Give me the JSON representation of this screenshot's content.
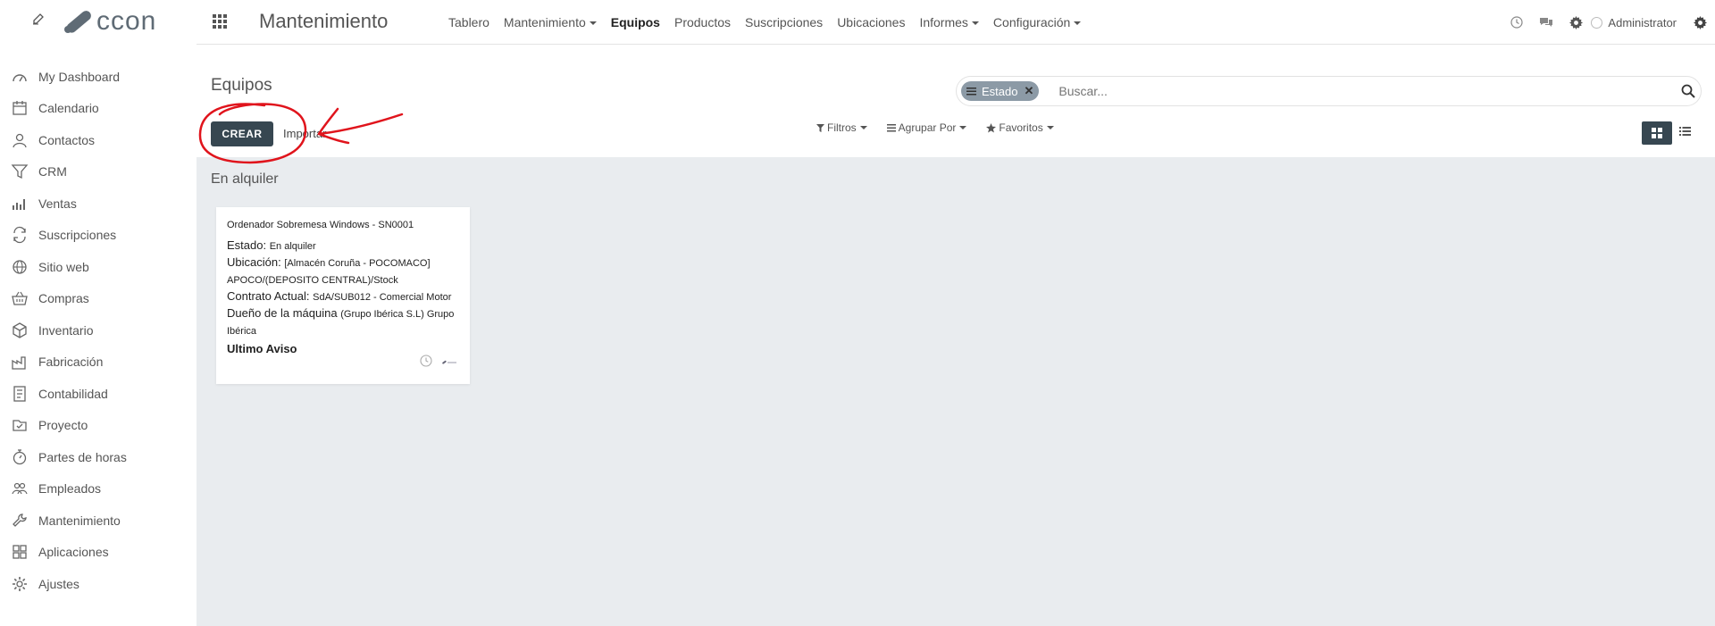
{
  "sidebar": {
    "logo_text": "ccon",
    "items": [
      {
        "label": "My Dashboard",
        "icon": "dashboard-icon"
      },
      {
        "label": "Calendario",
        "icon": "calendar-icon"
      },
      {
        "label": "Contactos",
        "icon": "contacts-icon"
      },
      {
        "label": "CRM",
        "icon": "filter-funnel-icon"
      },
      {
        "label": "Ventas",
        "icon": "sales-chart-icon"
      },
      {
        "label": "Suscripciones",
        "icon": "subscriptions-icon"
      },
      {
        "label": "Sitio web",
        "icon": "globe-icon"
      },
      {
        "label": "Compras",
        "icon": "basket-icon"
      },
      {
        "label": "Inventario",
        "icon": "box-icon"
      },
      {
        "label": "Fabricación",
        "icon": "factory-icon"
      },
      {
        "label": "Contabilidad",
        "icon": "accounting-icon"
      },
      {
        "label": "Proyecto",
        "icon": "project-icon"
      },
      {
        "label": "Partes de horas",
        "icon": "stopwatch-icon"
      },
      {
        "label": "Empleados",
        "icon": "employees-icon"
      },
      {
        "label": "Mantenimiento",
        "icon": "wrench-icon"
      },
      {
        "label": "Aplicaciones",
        "icon": "apps-grid-icon"
      },
      {
        "label": "Ajustes",
        "icon": "gear-icon"
      }
    ]
  },
  "navbar": {
    "app_title": "Mantenimiento",
    "menu": [
      {
        "label": "Tablero",
        "dropdown": false,
        "active": false
      },
      {
        "label": "Mantenimiento",
        "dropdown": true,
        "active": false
      },
      {
        "label": "Equipos",
        "dropdown": false,
        "active": true
      },
      {
        "label": "Productos",
        "dropdown": false,
        "active": false
      },
      {
        "label": "Suscripciones",
        "dropdown": false,
        "active": false
      },
      {
        "label": "Ubicaciones",
        "dropdown": false,
        "active": false
      },
      {
        "label": "Informes",
        "dropdown": true,
        "active": false
      },
      {
        "label": "Configuración",
        "dropdown": true,
        "active": false
      }
    ],
    "user": "Administrator"
  },
  "control_panel": {
    "breadcrumb": "Equipos",
    "create_label": "CREAR",
    "import_label": "Importar",
    "search": {
      "facet": "Estado",
      "placeholder": "Buscar..."
    },
    "filters_label": "Filtros",
    "groupby_label": "Agrupar Por",
    "favorites_label": "Favoritos"
  },
  "kanban": {
    "group_title": "En alquiler",
    "card": {
      "name": "Ordenador Sobremesa Windows - SN0001",
      "estado_label": "Estado:",
      "estado_value": "En alquiler",
      "ubicacion_label": "Ubicación:",
      "ubicacion_value": "[Almacén Coruña - POCOMACO] APOCO/(DEPOSITO CENTRAL)/Stock",
      "contrato_label": "Contrato Actual:",
      "contrato_value": "SdA/SUB012 - Comercial Motor",
      "dueno_label": "Dueño de la máquina",
      "dueno_value": "(Grupo Ibérica S.L) Grupo Ibérica",
      "ultimo_aviso_label": "Ultimo Aviso"
    }
  },
  "colors": {
    "primary": "#374751",
    "background": "#e9ecef",
    "facet": "#8c9aa6",
    "annotation": "#e0141c"
  }
}
